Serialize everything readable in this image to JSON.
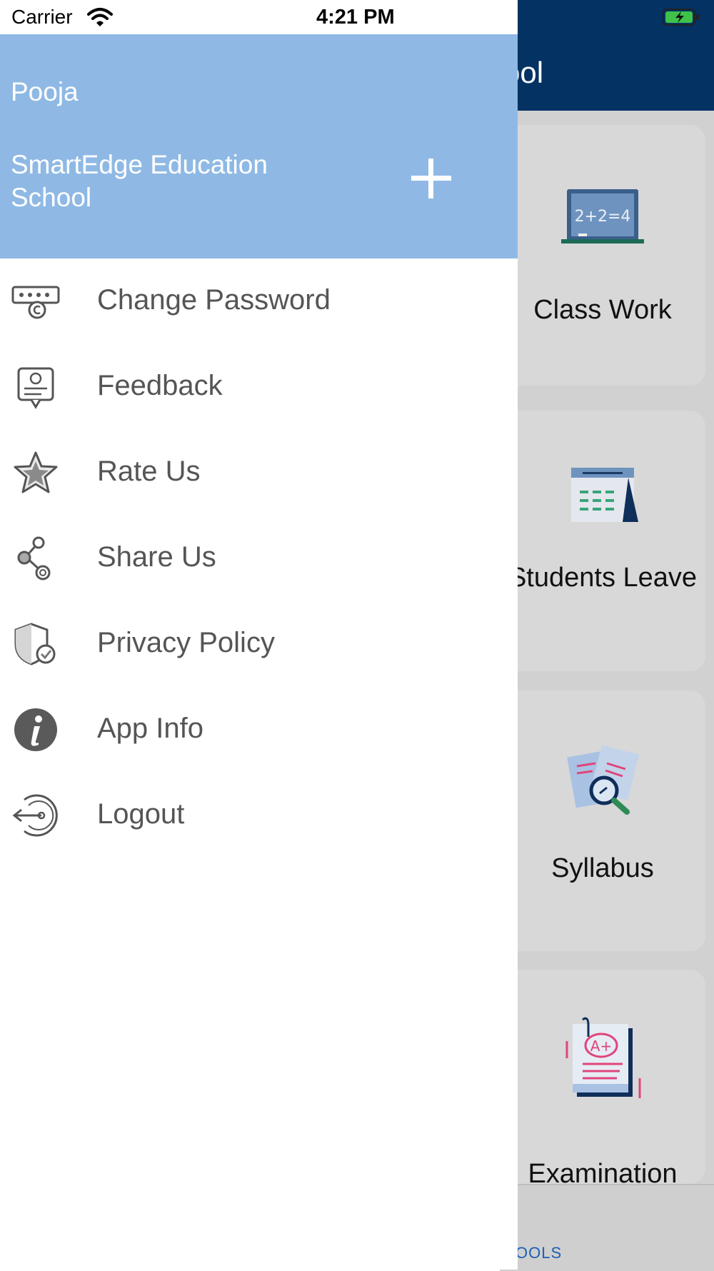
{
  "status_bar": {
    "carrier": "Carrier",
    "time": "4:21 PM"
  },
  "background_app": {
    "header_title": "ool",
    "cards": [
      {
        "label": "Class Work",
        "icon": "chalkboard-icon"
      },
      {
        "label": "Students Leave",
        "icon": "calendar-icon"
      },
      {
        "label": "Syllabus",
        "icon": "documents-search-icon"
      },
      {
        "label": "Examination",
        "icon": "exam-grade-icon"
      }
    ],
    "bottom_tab_label": "OOLS"
  },
  "drawer": {
    "user_name": "Pooja",
    "school_name": "SmartEdge Education School",
    "add_icon": "plus-icon",
    "menu_items": [
      {
        "label": "Change Password",
        "icon": "password-icon"
      },
      {
        "label": "Feedback",
        "icon": "feedback-icon"
      },
      {
        "label": "Rate Us",
        "icon": "star-icon"
      },
      {
        "label": "Share Us",
        "icon": "share-icon"
      },
      {
        "label": "Privacy Policy",
        "icon": "shield-check-icon"
      },
      {
        "label": "App Info",
        "icon": "info-icon"
      },
      {
        "label": "Logout",
        "icon": "logout-icon"
      }
    ]
  },
  "colors": {
    "profile_bg": "#8fb9e4",
    "header_bg": "#043263",
    "menu_text": "#555555"
  }
}
